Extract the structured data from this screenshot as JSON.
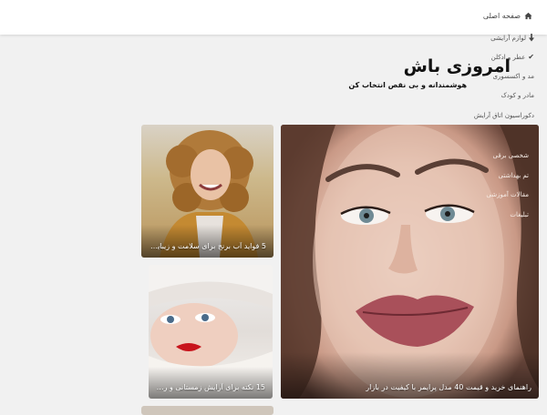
{
  "header": {
    "home_label": "صفحه اصلی",
    "home_icon": "home-icon"
  },
  "nav": {
    "items": [
      {
        "label": "لوازم آرایشی",
        "icon": "download-arrow-icon"
      },
      {
        "label": "عطر و ادکلن",
        "icon": "check-icon"
      },
      {
        "label": "مد و اکسسوری"
      },
      {
        "label": "مادر و کودک"
      },
      {
        "label": "دکوراسیون اتاق آرایش"
      }
    ],
    "overlay_items": [
      {
        "label": "شخصی برقی"
      },
      {
        "label": "تم بهداشتی"
      },
      {
        "label": "مقالات آموزشی"
      },
      {
        "label": "تبلیغات"
      }
    ]
  },
  "hero": {
    "title": "امروزی باش",
    "subtitle": "هوشمندانه و بی نقص انتخاب کن"
  },
  "articles": [
    {
      "caption": "راهنمای خرید و قیمت 40 مدل پرایمر با کیفیت در بازار"
    },
    {
      "caption": "5 فواید آب برنج برای سلامت و زیبایی..."
    },
    {
      "caption": "15 نکته برای آرایش زمستانی و روش..."
    }
  ]
}
